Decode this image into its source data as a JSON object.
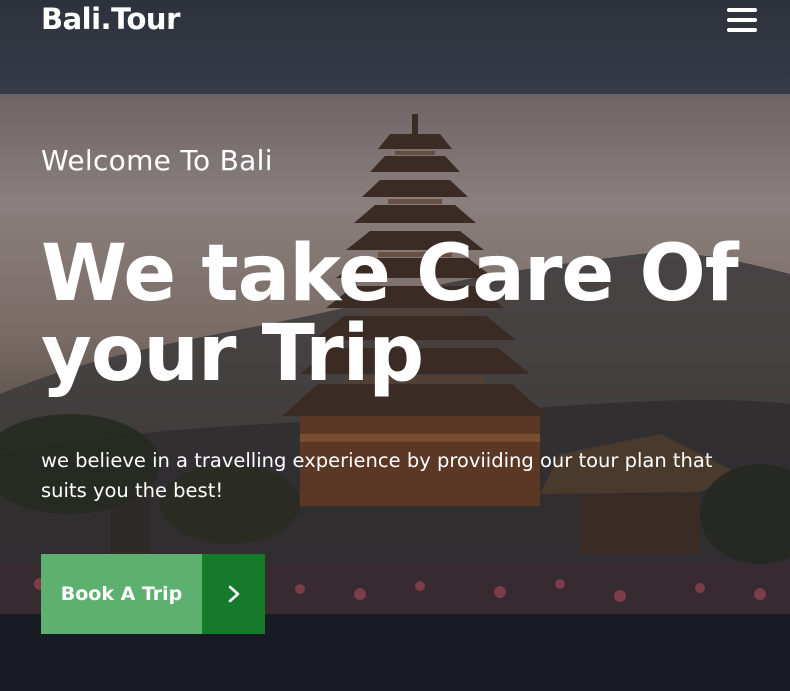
{
  "header": {
    "brand": "Bali.Tour",
    "menu_icon": "hamburger-menu-icon"
  },
  "hero": {
    "welcome": "Welcome To Bali",
    "headline_line1": "We take Care Of",
    "headline_line2": "your Trip",
    "tagline": "we believe in a travelling experience by proviiding our tour plan that suits you the best!",
    "cta_label": "Book A Trip",
    "cta_icon": "chevron-right-icon"
  },
  "colors": {
    "header_bg": "#343a47",
    "cta_primary": "#5db06f",
    "cta_secondary": "#167a2b",
    "text": "#ffffff"
  }
}
